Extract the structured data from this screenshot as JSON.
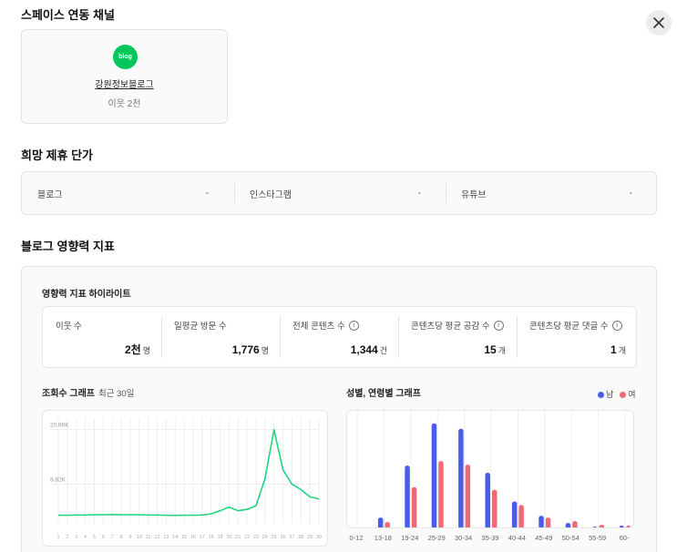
{
  "sections": {
    "space_channels": "스페이스 연동 채널",
    "desired_rate": "희망 제휴 단가",
    "influence": "블로그 영향력 지표"
  },
  "close_icon": "close-icon",
  "channel": {
    "badge": "blog",
    "name": "강원정보블로그",
    "neighbors": "이웃 2천",
    "brand_color": "#03c75a"
  },
  "rates": [
    {
      "label": "블로그",
      "value": "-"
    },
    {
      "label": "인스타그램",
      "value": "-"
    },
    {
      "label": "유튜브",
      "value": "-"
    }
  ],
  "highlights": {
    "title": "영향력 지표 하이라이트",
    "stats": [
      {
        "label": "이웃 수",
        "value": "2천",
        "unit": "명",
        "info": false
      },
      {
        "label": "일평균 방문 수",
        "value": "1,776",
        "unit": "명",
        "info": false
      },
      {
        "label": "전체 콘텐츠 수",
        "value": "1,344",
        "unit": "건",
        "info": true
      },
      {
        "label": "콘텐츠당 평균 공감 수",
        "value": "15",
        "unit": "개",
        "info": true
      },
      {
        "label": "콘텐츠당 평균 댓글 수",
        "value": "1",
        "unit": "개",
        "info": true
      }
    ]
  },
  "views_chart": {
    "title": "조회수 그래프",
    "subtitle": "최근 30일",
    "color": "#1ed47f"
  },
  "gender_chart": {
    "title": "성별, 연령별 그래프",
    "legend": [
      {
        "label": "남",
        "color": "#4b5de8"
      },
      {
        "label": "여",
        "color": "#f06a75"
      }
    ]
  },
  "chart_data": [
    {
      "type": "line",
      "x": [
        1,
        2,
        3,
        4,
        5,
        6,
        7,
        8,
        9,
        10,
        11,
        12,
        13,
        14,
        15,
        16,
        17,
        18,
        19,
        20,
        21,
        22,
        23,
        24,
        25,
        26,
        27,
        28,
        29,
        30
      ],
      "series": [
        {
          "values": [
            1900,
            1900,
            1950,
            1950,
            2000,
            2000,
            2050,
            2000,
            2000,
            2000,
            1950,
            1950,
            1900,
            1850,
            1900,
            1900,
            1950,
            2200,
            2900,
            3700,
            2900,
            3200,
            4000,
            10000,
            20900,
            12000,
            8800,
            7600,
            6000,
            5500
          ]
        }
      ],
      "yticks": [
        {
          "value": 8820,
          "label": "8.82K"
        },
        {
          "value": 20960,
          "label": "20.96K"
        }
      ],
      "ylim": [
        0,
        23500
      ],
      "grid": true
    },
    {
      "type": "bar",
      "categories": [
        "0-12",
        "13-18",
        "19-24",
        "25-29",
        "30-34",
        "35-39",
        "40-44",
        "45-49",
        "50-54",
        "55-59",
        "60-"
      ],
      "series": [
        {
          "name": "남",
          "values": [
            0,
            1.2,
            7.0,
            11.7,
            11.1,
            6.2,
            3.0,
            1.4,
            0.6,
            0.2,
            0.3
          ]
        },
        {
          "name": "여",
          "values": [
            0,
            0.7,
            4.6,
            7.5,
            7.1,
            4.3,
            2.6,
            1.2,
            0.8,
            0.4,
            0.3
          ]
        }
      ],
      "ylim": [
        0,
        12.5
      ],
      "grid": true
    }
  ]
}
